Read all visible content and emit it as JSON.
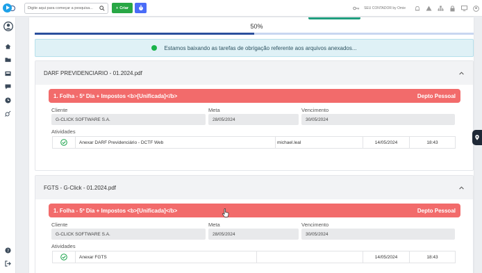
{
  "topbar": {
    "search_placeholder": "Digite aqui para começar a pesquisa...",
    "criar_label": "Criar",
    "contador_label": "SEU CONTADOR by Omie"
  },
  "progress": {
    "label": "50%",
    "fraction": 0.5
  },
  "alert": {
    "message": "Estamos baixando as tarefas de obrigação referente aos arquivos anexados..."
  },
  "files": [
    {
      "filename": "DARF PREVIDENCIARIO - 01.2024.pdf",
      "task_title": "1. Folha - 5º Dia + Impostos <b>[Unificada]</b>",
      "department": "Depto Pessoal",
      "cliente_label": "Cliente",
      "cliente": "G-CLICK SOFTWARE S.A.",
      "meta_label": "Meta",
      "meta": "28/05/2024",
      "vencimento_label": "Vencimento",
      "vencimento": "30/05/2024",
      "atividades_label": "Atividades",
      "activity": {
        "name": "Anexar DARF Previdenciário - DCTF Web",
        "user": "michael.leal",
        "date": "14/05/2024",
        "time": "18:43"
      }
    },
    {
      "filename": "FGTS - G-Click - 01.2024.pdf",
      "task_title": "1. Folha - 5º Dia + Impostos <b>[Unificada]</b>",
      "department": "Depto Pessoal",
      "cliente_label": "Cliente",
      "cliente": "G-CLICK SOFTWARE S.A.",
      "meta_label": "Meta",
      "meta": "28/05/2024",
      "vencimento_label": "Vencimento",
      "vencimento": "30/05/2024",
      "atividades_label": "Atividades",
      "activity": {
        "name": "Anexar FGTS",
        "user": "",
        "date": "14/05/2024",
        "time": "18:43"
      }
    }
  ],
  "colors": {
    "primary": "#2b4f9d",
    "banner": "#f26b6b",
    "success": "#19b34a",
    "criar": "#28a745"
  }
}
